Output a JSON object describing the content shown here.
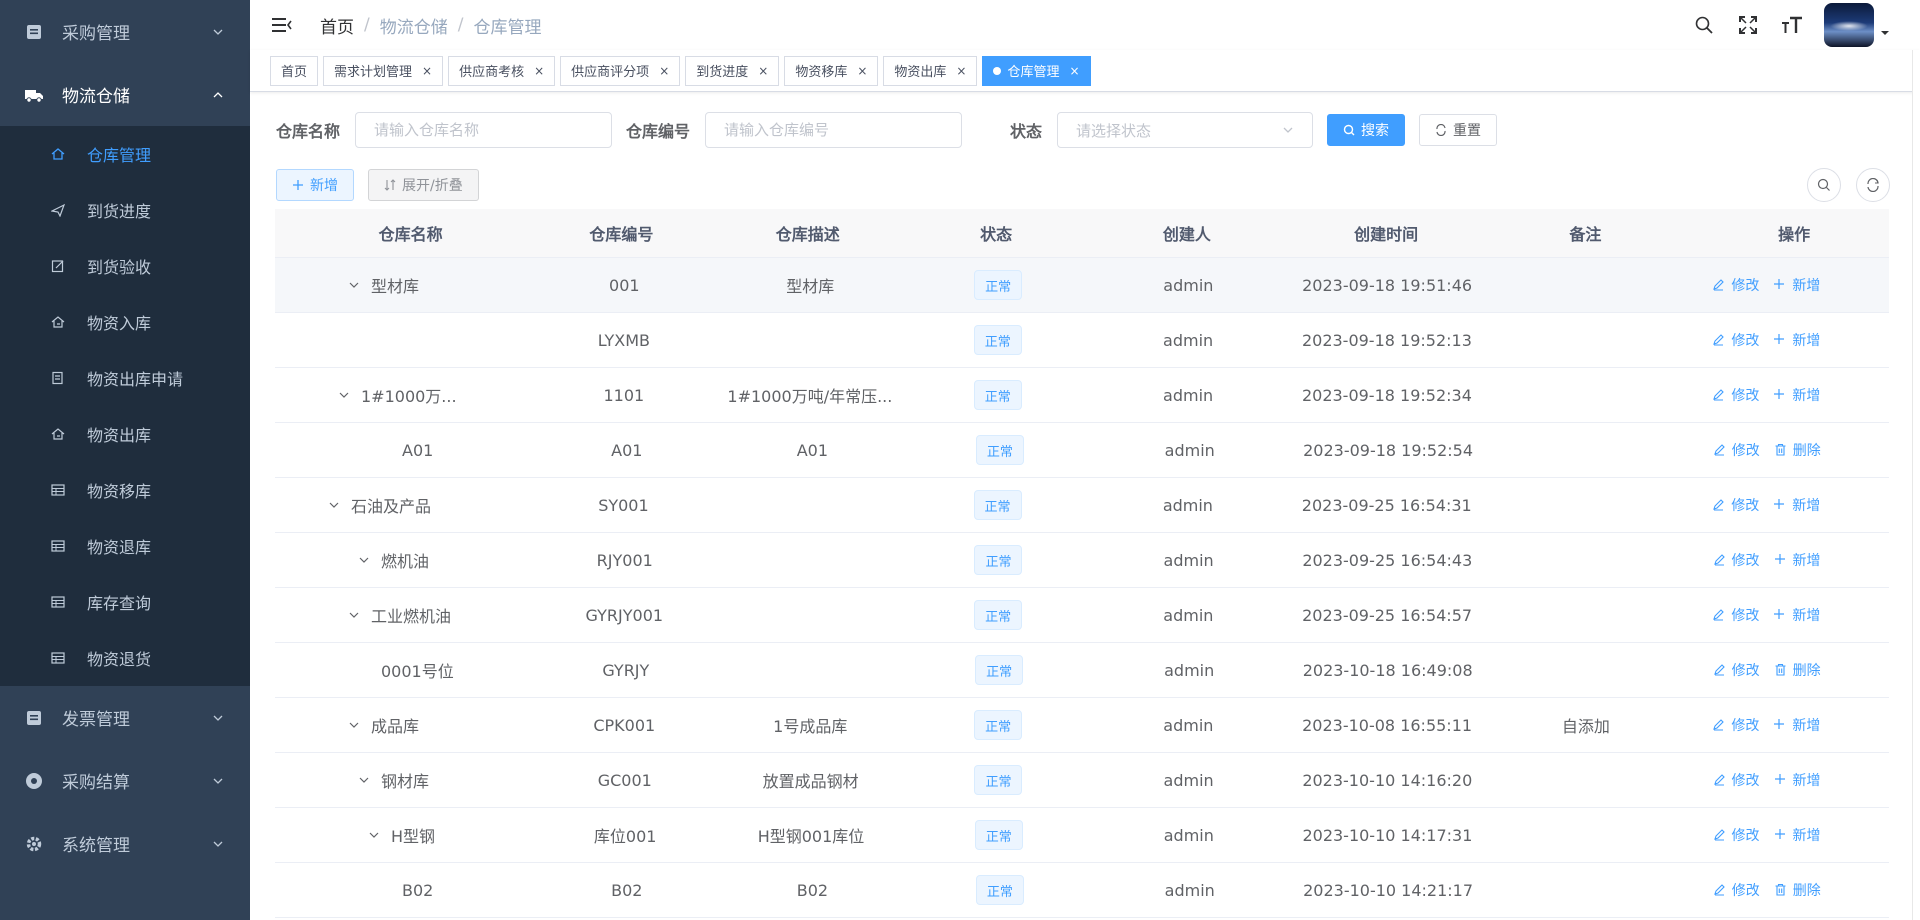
{
  "sidebar": {
    "groups": [
      {
        "label": "采购管理",
        "icon": "document-icon",
        "open": false
      },
      {
        "label": "物流仓储",
        "icon": "truck-icon",
        "open": true
      },
      {
        "label": "发票管理",
        "icon": "document-icon",
        "open": false
      },
      {
        "label": "采购结算",
        "icon": "settlement-icon",
        "open": false
      },
      {
        "label": "系统管理",
        "icon": "gear-icon",
        "open": false
      }
    ],
    "sub_items": [
      {
        "label": "仓库管理",
        "icon": "home-icon",
        "active": true
      },
      {
        "label": "到货进度",
        "icon": "send-icon",
        "active": false
      },
      {
        "label": "到货验收",
        "icon": "edit-icon",
        "active": false
      },
      {
        "label": "物资入库",
        "icon": "house-in-icon",
        "active": false
      },
      {
        "label": "物资出库申请",
        "icon": "file-icon",
        "active": false
      },
      {
        "label": "物资出库",
        "icon": "house-out-icon",
        "active": false
      },
      {
        "label": "物资移库",
        "icon": "table-icon",
        "active": false
      },
      {
        "label": "物资退库",
        "icon": "table-icon",
        "active": false
      },
      {
        "label": "库存查询",
        "icon": "table-icon",
        "active": false
      },
      {
        "label": "物资退货",
        "icon": "table-icon",
        "active": false
      }
    ]
  },
  "breadcrumb": [
    "首页",
    "物流仓储",
    "仓库管理"
  ],
  "tags": [
    {
      "label": "首页",
      "closable": false,
      "active": false
    },
    {
      "label": "需求计划管理",
      "closable": true,
      "active": false
    },
    {
      "label": "供应商考核",
      "closable": true,
      "active": false
    },
    {
      "label": "供应商评分项",
      "closable": true,
      "active": false
    },
    {
      "label": "到货进度",
      "closable": true,
      "active": false
    },
    {
      "label": "物资移库",
      "closable": true,
      "active": false
    },
    {
      "label": "物资出库",
      "closable": true,
      "active": false
    },
    {
      "label": "仓库管理",
      "closable": true,
      "active": true
    }
  ],
  "search": {
    "name_label": "仓库名称",
    "name_placeholder": "请输入仓库名称",
    "code_label": "仓库编号",
    "code_placeholder": "请输入仓库编号",
    "status_label": "状态",
    "status_placeholder": "请选择状态",
    "search_btn": "搜索",
    "reset_btn": "重置"
  },
  "toolbar": {
    "add_btn": "新增",
    "expand_btn": "展开/折叠"
  },
  "table": {
    "headers": [
      "仓库名称",
      "仓库编号",
      "仓库描述",
      "状态",
      "创建人",
      "创建时间",
      "备注",
      "操作"
    ],
    "op_edit": "修改",
    "op_add": "新增",
    "op_delete": "删除",
    "rows": [
      {
        "name": "型材库",
        "indent": 1,
        "expand": true,
        "code": "001",
        "desc": "型材库",
        "status": "正常",
        "creator": "admin",
        "time": "2023-09-18 19:51:46",
        "remark": "",
        "second_op": "add",
        "hover": true
      },
      {
        "name": "",
        "indent": 0,
        "expand": false,
        "code": "LYXMB",
        "desc": "",
        "status": "正常",
        "creator": "admin",
        "time": "2023-09-18 19:52:13",
        "remark": "",
        "second_op": "add"
      },
      {
        "name": "1#1000万...",
        "indent": 0,
        "expand": true,
        "code": "1101",
        "desc": "1#1000万吨/年常压...",
        "status": "正常",
        "creator": "admin",
        "time": "2023-09-18 19:52:34",
        "remark": "",
        "second_op": "add"
      },
      {
        "name": "A01",
        "indent": 3,
        "expand": false,
        "code": "A01",
        "desc": "A01",
        "status": "正常",
        "creator": "admin",
        "time": "2023-09-18 19:52:54",
        "remark": "",
        "second_op": "delete"
      },
      {
        "name": "石油及产品",
        "indent": -1,
        "expand": true,
        "code": "SY001",
        "desc": "",
        "status": "正常",
        "creator": "admin",
        "time": "2023-09-25 16:54:31",
        "remark": "",
        "second_op": "add"
      },
      {
        "name": "燃机油",
        "indent": 2,
        "expand": true,
        "code": "RJY001",
        "desc": "",
        "status": "正常",
        "creator": "admin",
        "time": "2023-09-25 16:54:43",
        "remark": "",
        "second_op": "add"
      },
      {
        "name": "工业燃机油",
        "indent": 1,
        "expand": true,
        "code": "GYRJY001",
        "desc": "",
        "status": "正常",
        "creator": "admin",
        "time": "2023-09-25 16:54:57",
        "remark": "",
        "second_op": "add"
      },
      {
        "name": "0001号位",
        "indent": 4,
        "expand": false,
        "code": "GYRJY",
        "desc": "",
        "status": "正常",
        "creator": "admin",
        "time": "2023-10-18 16:49:08",
        "remark": "",
        "second_op": "delete"
      },
      {
        "name": "成品库",
        "indent": 1,
        "expand": true,
        "code": "CPK001",
        "desc": "1号成品库",
        "status": "正常",
        "creator": "admin",
        "time": "2023-10-08 16:55:11",
        "remark": "自添加",
        "second_op": "add"
      },
      {
        "name": "钢材库",
        "indent": 2,
        "expand": true,
        "code": "GC001",
        "desc": "放置成品钢材",
        "status": "正常",
        "creator": "admin",
        "time": "2023-10-10 14:16:20",
        "remark": "",
        "second_op": "add"
      },
      {
        "name": "H型钢",
        "indent": 3,
        "expand": true,
        "code": "库位001",
        "desc": "H型钢001库位",
        "status": "正常",
        "creator": "admin",
        "time": "2023-10-10 14:17:31",
        "remark": "",
        "second_op": "add"
      },
      {
        "name": "B02",
        "indent": 3,
        "expand": false,
        "code": "B02",
        "desc": "B02",
        "status": "正常",
        "creator": "admin",
        "time": "2023-10-10 14:21:17",
        "remark": "",
        "second_op": "delete"
      }
    ]
  },
  "colors": {
    "primary": "#409eff",
    "sidebar_bg": "#304156",
    "submenu_bg": "#1f2d3d"
  }
}
